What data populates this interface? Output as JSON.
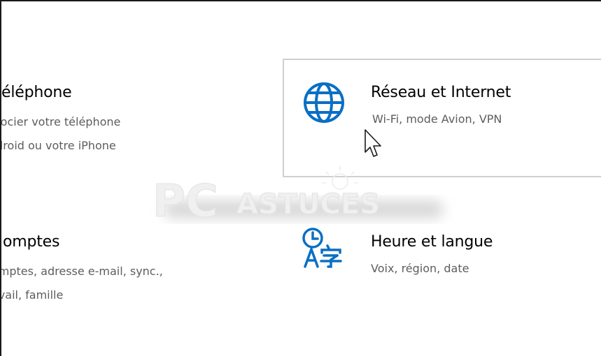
{
  "tiles": {
    "phone": {
      "title": "éléphone",
      "desc_line1": "ssocier votre téléphone",
      "desc_line2": "ndroid ou votre iPhone"
    },
    "network": {
      "title": "Réseau et Internet",
      "desc": "Wi-Fi, mode Avion, VPN",
      "icon": "globe-icon"
    },
    "accounts": {
      "title": "omptes",
      "desc_line1": "omptes, adresse e-mail, sync.,",
      "desc_line2": "avail, famille"
    },
    "time_language": {
      "title": "Heure et langue",
      "desc": "Voix, région, date",
      "icon": "time-language-icon"
    }
  },
  "watermark": {
    "text_pc": "PC",
    "text_astuces": "ASTUCES"
  },
  "colors": {
    "accent": "#0a6fc4",
    "hover_border": "#cfcfcf",
    "desc_text": "#5d5d5d"
  }
}
